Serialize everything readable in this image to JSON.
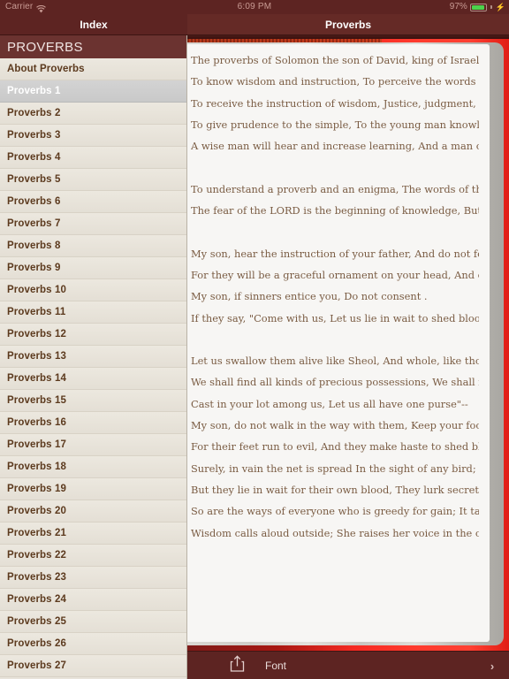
{
  "status_bar": {
    "carrier": "Carrier",
    "wifi_icon": "wifi-icon",
    "time": "6:09 PM",
    "battery_percent": "97%",
    "battery_icon": "battery-icon",
    "charging_icon": "lightning-bolt-icon"
  },
  "nav": {
    "left_title": "Index",
    "right_title": "Proverbs"
  },
  "sidebar": {
    "header": "PROVERBS",
    "items": [
      {
        "label": "About Proverbs",
        "selected": false
      },
      {
        "label": "Proverbs 1",
        "selected": true
      },
      {
        "label": "Proverbs 2",
        "selected": false
      },
      {
        "label": "Proverbs 3",
        "selected": false
      },
      {
        "label": "Proverbs 4",
        "selected": false
      },
      {
        "label": "Proverbs 5",
        "selected": false
      },
      {
        "label": "Proverbs 6",
        "selected": false
      },
      {
        "label": "Proverbs 7",
        "selected": false
      },
      {
        "label": "Proverbs 8",
        "selected": false
      },
      {
        "label": "Proverbs 9",
        "selected": false
      },
      {
        "label": "Proverbs 10",
        "selected": false
      },
      {
        "label": "Proverbs 11",
        "selected": false
      },
      {
        "label": "Proverbs 12",
        "selected": false
      },
      {
        "label": "Proverbs 13",
        "selected": false
      },
      {
        "label": "Proverbs 14",
        "selected": false
      },
      {
        "label": "Proverbs 15",
        "selected": false
      },
      {
        "label": "Proverbs 16",
        "selected": false
      },
      {
        "label": "Proverbs 17",
        "selected": false
      },
      {
        "label": "Proverbs 18",
        "selected": false
      },
      {
        "label": "Proverbs 19",
        "selected": false
      },
      {
        "label": "Proverbs 20",
        "selected": false
      },
      {
        "label": "Proverbs 21",
        "selected": false
      },
      {
        "label": "Proverbs 22",
        "selected": false
      },
      {
        "label": "Proverbs 23",
        "selected": false
      },
      {
        "label": "Proverbs 24",
        "selected": false
      },
      {
        "label": "Proverbs 25",
        "selected": false
      },
      {
        "label": "Proverbs 26",
        "selected": false
      },
      {
        "label": "Proverbs 27",
        "selected": false
      }
    ]
  },
  "page": {
    "lines": [
      "The proverbs of Solomon the son of David, king of Israel:",
      "To know wisdom and instruction, To perceive the words of understanding,",
      "To receive the instruction of wisdom, Justice, judgment, and equity;",
      "To give prudence to the simple, To the young man knowledge and discretion--",
      "A wise man will hear and increase learning, And a man of understanding will attain wise",
      "",
      "To understand a proverb and an enigma, The words of the wise and their riddles .",
      "The fear of the LORD is the beginning of knowledge, But fools despise wisdom and",
      "",
      "My son, hear the instruction of your father, And do not forsake the law of your mother;",
      "For they will be a graceful ornament on your head, And chains about your neck.",
      "My son, if sinners entice you, Do not consent .",
      "If they say, \"Come with us, Let us lie in wait to shed blood; Let us lurk secretly for the",
      "",
      "Let us swallow them alive like Sheol, And whole, like those who go down to the Pit;",
      "We shall find all kinds of precious possessions, We shall fill our houses with spoil;",
      "Cast in your lot among us, Let us all have one purse\"--",
      "My son, do not walk in the way with them, Keep your foot from their path;",
      "For their feet run to evil, And they make haste to shed blood .",
      "Surely, in vain the net is spread In the sight of any bird;",
      "But they lie in wait for their own blood, They lurk secretly for their own lives .",
      "So are the ways of everyone who is greedy for gain; It takes away the life of its owners.",
      "Wisdom calls aloud outside; She raises her voice in the open squares."
    ]
  },
  "toolbar": {
    "share_icon": "share-icon",
    "font_label": "Font",
    "next_icon": "chevron-right-icon"
  },
  "colors": {
    "navbar": "#5d2422",
    "sidebar_bg": "#e8e3da",
    "sidebar_header": "#6b3330",
    "selected_row": "#cfcfcf",
    "book_cover_red": "#f62a22",
    "page": "#f7f6f4",
    "text_brown": "#7a5c43",
    "battery_green": "#4cd24c"
  }
}
